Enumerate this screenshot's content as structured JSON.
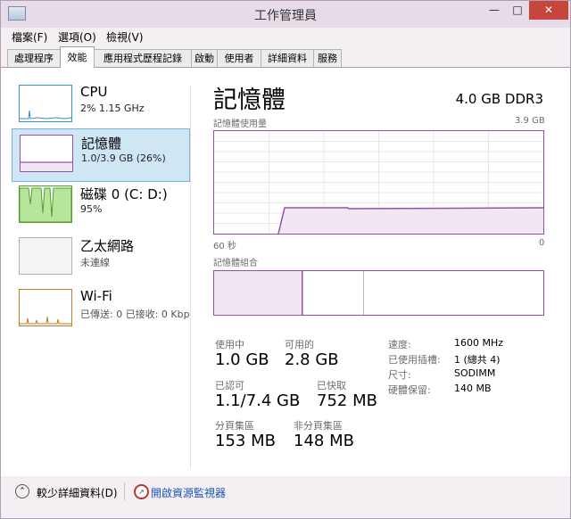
{
  "window": {
    "title": "工作管理員",
    "controls": {
      "minimize": "—",
      "maximize": "□",
      "close": "✕"
    }
  },
  "menu": [
    "檔案(F)",
    "選項(O)",
    "檢視(V)"
  ],
  "tabs": [
    "處理程序",
    "效能",
    "應用程式歷程記錄",
    "啟動",
    "使用者",
    "詳細資料",
    "服務"
  ],
  "active_tab": "效能",
  "sidebar": [
    {
      "title": "CPU",
      "subtitle": "2% 1.15 GHz",
      "color": "#3a8fc4"
    },
    {
      "title": "記憶體",
      "subtitle": "1.0/3.9 GB (26%)",
      "color": "#9a4eab",
      "selected": true
    },
    {
      "title": "磁碟 0 (C: D:)",
      "subtitle": "95%",
      "color": "#4da028"
    },
    {
      "title": "乙太網路",
      "subtitle": "未連線",
      "color": "#b0b0b0"
    },
    {
      "title": "Wi-Fi",
      "subtitle": "已傳送: 0 已接收: 0 Kbps",
      "color": "#c07a2a"
    }
  ],
  "main": {
    "title": "記憶體",
    "spec": "4.0 GB DDR3",
    "usage_chart": {
      "label": "記憶體使用量",
      "max": "3.9 GB",
      "x_left": "60 秒",
      "x_right": "0"
    },
    "composition_label": "記憶體組合",
    "stats": {
      "in_use": {
        "label": "使用中",
        "value": "1.0 GB"
      },
      "available": {
        "label": "可用的",
        "value": "2.8 GB"
      },
      "committed": {
        "label": "已認可",
        "value": "1.1/7.4 GB"
      },
      "cached": {
        "label": "已快取",
        "value": "752 MB"
      },
      "paged_pool": {
        "label": "分頁集區",
        "value": "153 MB"
      },
      "nonpaged_pool": {
        "label": "非分頁集區",
        "value": "148 MB"
      }
    },
    "specs": [
      {
        "key": "速度:",
        "value": "1600 MHz"
      },
      {
        "key": "已使用插槽:",
        "value": "1 (總共 4)"
      },
      {
        "key": "尺寸:",
        "value": "SODIMM"
      },
      {
        "key": "硬體保留:",
        "value": "140 MB"
      }
    ]
  },
  "footer": {
    "fewer_details": "較少詳細資料(D)",
    "open_monitor": "開啟資源監視器"
  }
}
